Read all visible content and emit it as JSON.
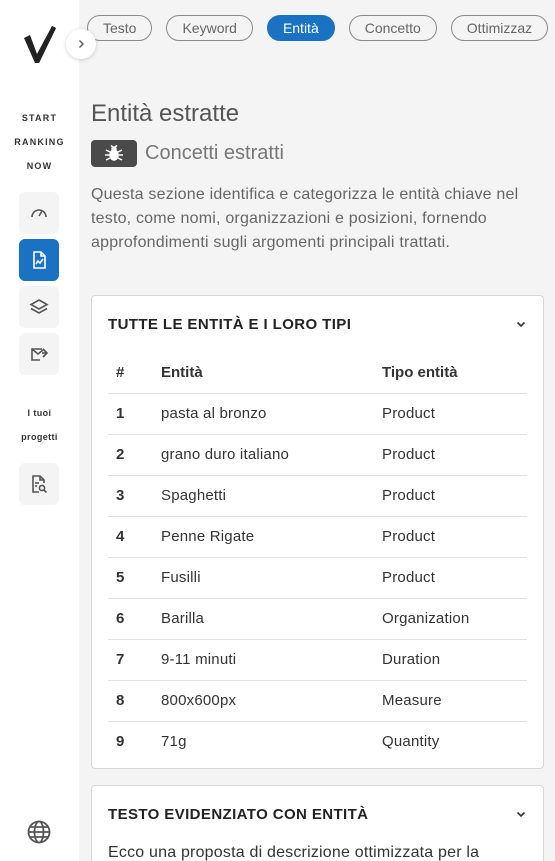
{
  "sidebar": {
    "brand_lines": [
      "START",
      "RANKING",
      "NOW"
    ],
    "projects_lines": [
      "I tuoi",
      "progetti"
    ],
    "nav_icons": [
      "gauge-icon",
      "document-chart-icon",
      "layers-icon",
      "mail-share-icon"
    ],
    "active_index": 1,
    "project_icon": "document-search-icon"
  },
  "tabs": [
    {
      "label": "Testo",
      "active": false
    },
    {
      "label": "Keyword",
      "active": false
    },
    {
      "label": "Entità",
      "active": true
    },
    {
      "label": "Concetto",
      "active": false
    },
    {
      "label": "Ottimizzaz",
      "active": false
    }
  ],
  "main": {
    "title": "Entità estratte",
    "subtitle": "Concetti estratti",
    "description": "Questa sezione identifica e categorizza le entità chiave nel testo, come nomi, organizzazioni e posizioni, fornendo approfondimenti sugli argomenti principali trattati."
  },
  "entities_card": {
    "title": "TUTTE LE ENTITÀ E I LORO TIPI",
    "columns": [
      "#",
      "Entità",
      "Tipo entità"
    ],
    "rows": [
      {
        "n": "1",
        "entity": "pasta al bronzo",
        "type": "Product"
      },
      {
        "n": "2",
        "entity": "grano duro italiano",
        "type": "Product"
      },
      {
        "n": "3",
        "entity": "Spaghetti",
        "type": "Product"
      },
      {
        "n": "4",
        "entity": "Penne Rigate",
        "type": "Product"
      },
      {
        "n": "5",
        "entity": "Fusilli",
        "type": "Product"
      },
      {
        "n": "6",
        "entity": "Barilla",
        "type": "Organization"
      },
      {
        "n": "7",
        "entity": "9-11 minuti",
        "type": "Duration"
      },
      {
        "n": "8",
        "entity": "800x600px",
        "type": "Measure"
      },
      {
        "n": "9",
        "entity": "71g",
        "type": "Quantity"
      }
    ]
  },
  "highlight_card": {
    "title": "TESTO EVIDENZIATO CON ENTITÀ",
    "text": "Ecco una proposta di descrizione ottimizzata per la"
  },
  "colors": {
    "accent": "#1a73c2",
    "badge": "#4a4a4a"
  }
}
